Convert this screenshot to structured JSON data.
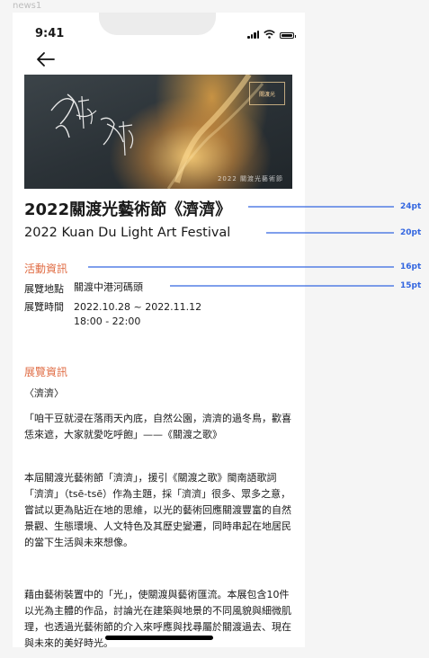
{
  "frame_label": "news1",
  "status_bar": {
    "time": "9:41"
  },
  "hero": {
    "alt": "濟濟 poster artwork",
    "calligraphy": "濟濟",
    "logo_text": "關渡光",
    "caption": "2022 關渡光藝術節"
  },
  "title": {
    "zh": "2022關渡光藝術節《濟濟》",
    "en": "2022 Kuan Du Light Art Festival"
  },
  "event_info": {
    "heading": "活動資訊",
    "location_label": "展覽地點",
    "location_value": "關渡中港河碼頭",
    "time_label": "展覽時間",
    "time_dates": "2022.10.28 ~ 2022.11.12",
    "time_hours": "18:00 - 22:00"
  },
  "exhibition_info": {
    "heading": "展覽資訊",
    "subtitle": "〈濟濟〉",
    "quote": "「咱干豆就浸在落雨天內底，自然公園，濟濟的過冬鳥，歡喜恁來遮，大家就愛吃呼飽」——《關渡之歌》",
    "para1": "本屆關渡光藝術節「濟濟」，援引《關渡之歌》閩南語歌詞「濟濟」（tsē-tsē）作為主題，採「濟濟」很多、眾多之意，嘗試以更為貼近在地的思維，以光的藝術回應關渡豐富的自然景觀、生態環境、人文特色及其歷史變遷，同時串起在地居民的當下生活與未來想像。",
    "para2": "藉由藝術裝置中的「光」，使關渡與藝術匯流。本展包含10件以光為主體的作品，討論光在建築與地景的不同風貌與細微肌理，也透過光藝術節的介入來呼應與找尋屬於關渡過去、現在與未來的美好時光。"
  },
  "annotations": [
    {
      "label": "24pt"
    },
    {
      "label": "20pt"
    },
    {
      "label": "16pt"
    },
    {
      "label": "15pt"
    }
  ],
  "colors": {
    "section_heading": "#e06d45",
    "annotation": "#3366e0",
    "text": "#1a1a1a"
  }
}
